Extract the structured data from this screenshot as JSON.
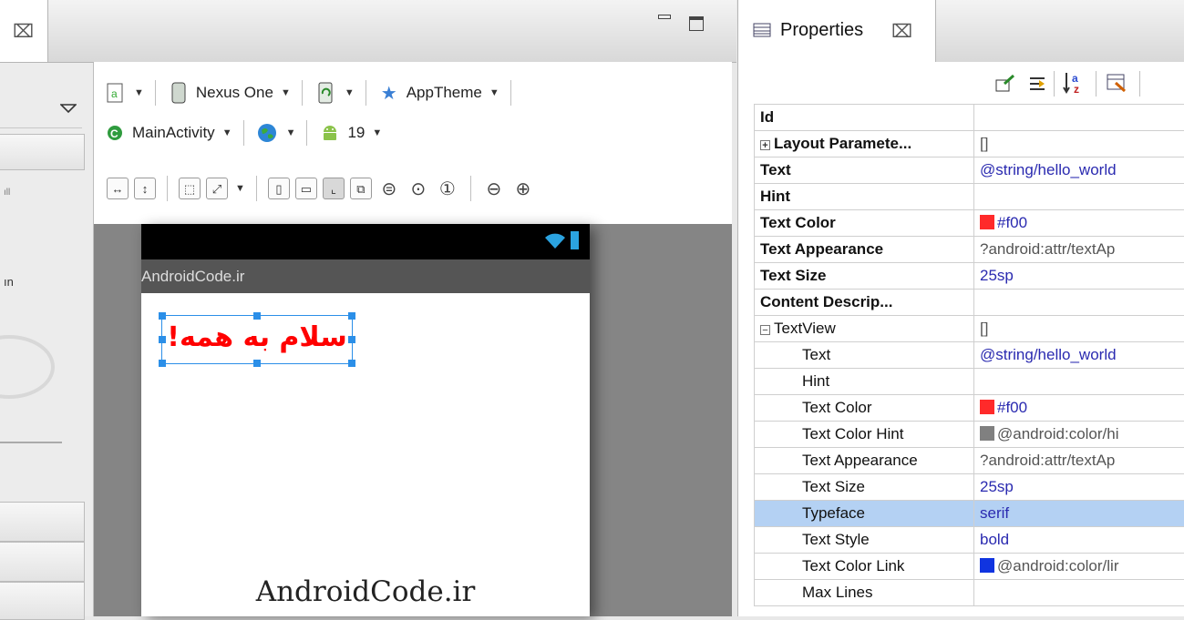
{
  "left_palette": {
    "fragments": [
      "ıll",
      "ın"
    ]
  },
  "canvas": {
    "toolbar_row1": {
      "device": "Nexus One",
      "theme": "AppTheme"
    },
    "toolbar_row2": {
      "activity": "MainActivity",
      "api_level": "19"
    },
    "phone": {
      "action_bar_title": "AndroidCode.ir",
      "textview_text": "سلام به همه!",
      "footer_text": "AndroidCode.ir"
    }
  },
  "properties": {
    "tab_title": "Properties",
    "rows": [
      {
        "name": "Id",
        "value": ""
      },
      {
        "name": "Layout Paramete...",
        "value": "[]"
      },
      {
        "name": "Text",
        "value": "@string/hello_world"
      },
      {
        "name": "Hint",
        "value": ""
      },
      {
        "name": "Text Color",
        "value": "#f00",
        "swatch": "#ff2a2a"
      },
      {
        "name": "Text Appearance",
        "value": "?android:attr/textAp"
      },
      {
        "name": "Text Size",
        "value": "25sp"
      },
      {
        "name": "Content Descrip...",
        "value": ""
      },
      {
        "name": "TextView",
        "value": "[]"
      },
      {
        "name": "Text",
        "value": "@string/hello_world"
      },
      {
        "name": "Hint",
        "value": ""
      },
      {
        "name": "Text Color",
        "value": "#f00",
        "swatch": "#ff2a2a"
      },
      {
        "name": "Text Color Hint",
        "value": "@android:color/hi",
        "swatch": "#808080"
      },
      {
        "name": "Text Appearance",
        "value": "?android:attr/textAp"
      },
      {
        "name": "Text Size",
        "value": "25sp"
      },
      {
        "name": "Typeface",
        "value": "serif"
      },
      {
        "name": "Text Style",
        "value": "bold"
      },
      {
        "name": "Text Color Link",
        "value": "@android:color/lir",
        "swatch": "#1034e0"
      },
      {
        "name": "Max Lines",
        "value": ""
      }
    ]
  },
  "colors": {
    "selection": "#b4d1f3",
    "handle": "#2b8fe8",
    "text_red": "#ff0000"
  }
}
